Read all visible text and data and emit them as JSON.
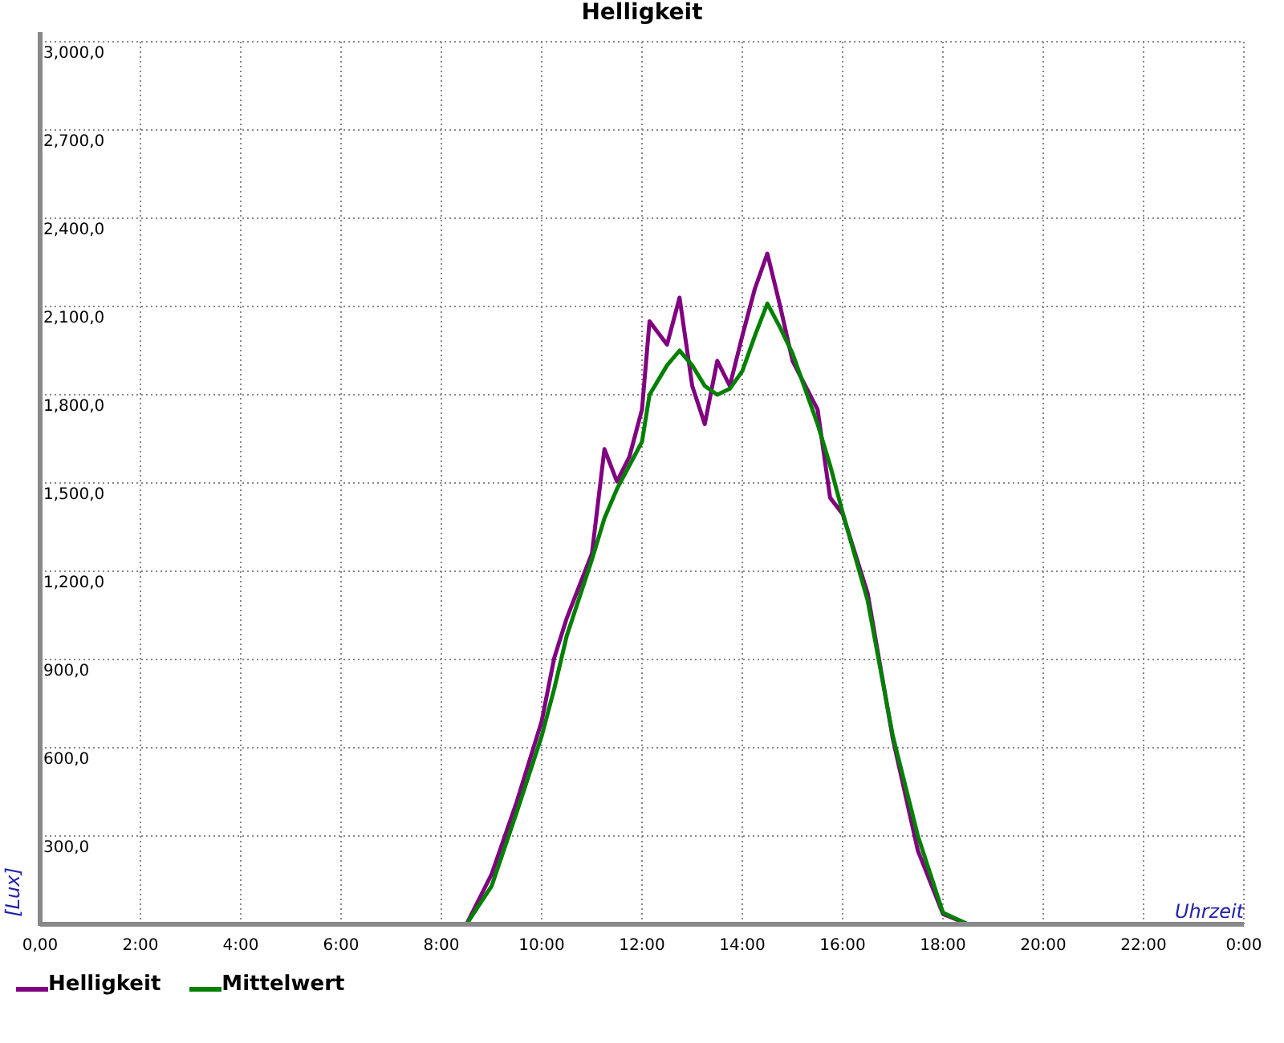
{
  "chart_data": {
    "type": "line",
    "title": "Helligkeit",
    "xlabel": "Uhrzeit",
    "ylabel": "[Lux]",
    "x": [
      0,
      8,
      8.5,
      9,
      9.5,
      10,
      10.25,
      10.5,
      11,
      11.25,
      11.5,
      11.75,
      12,
      12.15,
      12.5,
      12.75,
      13,
      13.25,
      13.5,
      13.75,
      14,
      14.25,
      14.5,
      14.75,
      15,
      15.5,
      15.75,
      16,
      16.5,
      17,
      17.5,
      18,
      18.5,
      24
    ],
    "series": [
      {
        "name": "Helligkeit",
        "color": "#800080",
        "values": [
          0,
          0,
          0,
          170,
          415,
          690,
          905,
          1040,
          1260,
          1615,
          1505,
          1590,
          1750,
          2050,
          1970,
          2130,
          1830,
          1700,
          1915,
          1830,
          2000,
          2160,
          2280,
          2105,
          1915,
          1750,
          1450,
          1395,
          1125,
          630,
          250,
          35,
          0,
          0
        ]
      },
      {
        "name": "Mittelwert",
        "color": "#008000",
        "values": [
          0,
          0,
          0,
          130,
          380,
          640,
          800,
          980,
          1240,
          1380,
          1480,
          1560,
          1640,
          1800,
          1900,
          1950,
          1900,
          1830,
          1800,
          1820,
          1880,
          2000,
          2110,
          2030,
          1940,
          1700,
          1560,
          1400,
          1100,
          640,
          300,
          40,
          0,
          0
        ]
      }
    ],
    "grid": true,
    "xlim": [
      0,
      24
    ],
    "ylim": [
      0,
      3000
    ],
    "xticks": [
      {
        "value": 0,
        "label": "0,00"
      },
      {
        "value": 2,
        "label": "2:00"
      },
      {
        "value": 4,
        "label": "4:00"
      },
      {
        "value": 6,
        "label": "6:00"
      },
      {
        "value": 8,
        "label": "8:00"
      },
      {
        "value": 10,
        "label": "10:00"
      },
      {
        "value": 12,
        "label": "12:00"
      },
      {
        "value": 14,
        "label": "14:00"
      },
      {
        "value": 16,
        "label": "16:00"
      },
      {
        "value": 18,
        "label": "18:00"
      },
      {
        "value": 20,
        "label": "20:00"
      },
      {
        "value": 22,
        "label": "22:00"
      },
      {
        "value": 24,
        "label": "0:00"
      }
    ],
    "yticks": [
      {
        "value": 300,
        "label": "300,0"
      },
      {
        "value": 600,
        "label": "600,0"
      },
      {
        "value": 900,
        "label": "900,0"
      },
      {
        "value": 1200,
        "label": "1,200,0"
      },
      {
        "value": 1500,
        "label": "1,500,0"
      },
      {
        "value": 1800,
        "label": "1,800,0"
      },
      {
        "value": 2100,
        "label": "2,100,0"
      },
      {
        "value": 2400,
        "label": "2,400,0"
      },
      {
        "value": 2700,
        "label": "2,700,0"
      },
      {
        "value": 3000,
        "label": "3,000,0"
      }
    ]
  }
}
